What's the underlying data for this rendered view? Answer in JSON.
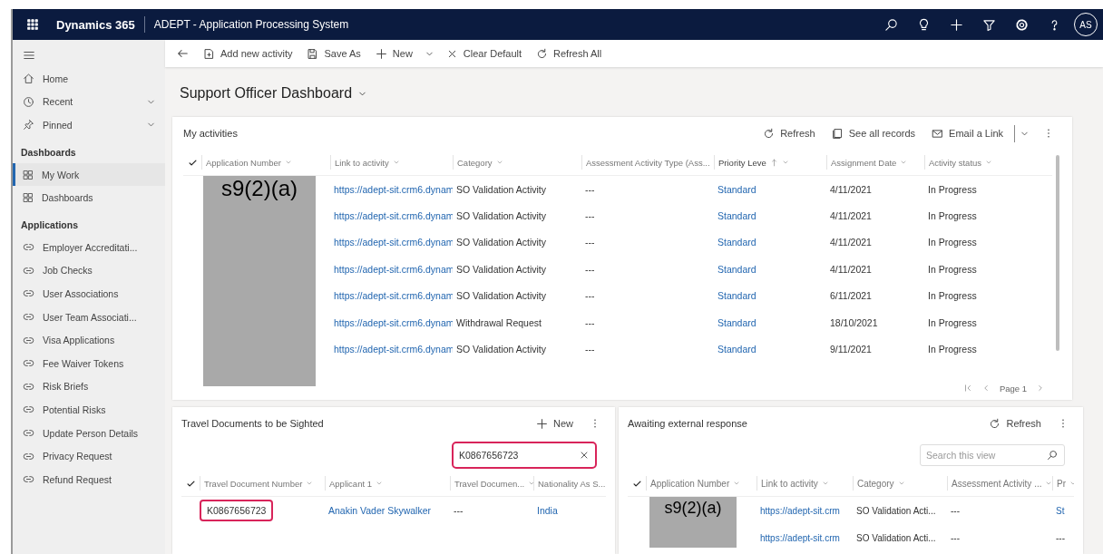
{
  "app_bar": {
    "app_name": "Dynamics 365",
    "title": "ADEPT - Application Processing System",
    "avatar": "AS"
  },
  "sidebar": {
    "top_items": [
      {
        "label": "Home",
        "kind": "link"
      },
      {
        "label": "Recent",
        "kind": "group"
      },
      {
        "label": "Pinned",
        "kind": "group"
      }
    ],
    "sections": [
      {
        "title": "Dashboards",
        "items": [
          {
            "label": "My Work",
            "selected": true
          },
          {
            "label": "Dashboards",
            "selected": false
          }
        ]
      },
      {
        "title": "Applications",
        "items": [
          {
            "label": "Employer Accreditati...",
            "selected": false
          },
          {
            "label": "Job Checks",
            "selected": false
          },
          {
            "label": "User Associations",
            "selected": false
          },
          {
            "label": "User Team Associati...",
            "selected": false
          },
          {
            "label": "Visa Applications",
            "selected": false
          },
          {
            "label": "Fee Waiver Tokens",
            "selected": false
          },
          {
            "label": "Risk Briefs",
            "selected": false
          },
          {
            "label": "Potential Risks",
            "selected": false
          },
          {
            "label": "Update Person Details",
            "selected": false
          },
          {
            "label": "Privacy Request",
            "selected": false
          },
          {
            "label": "Refund Request",
            "selected": false
          }
        ]
      }
    ]
  },
  "command_bar": [
    {
      "label": "Add new activity",
      "kind": "button"
    },
    {
      "label": "Save As",
      "kind": "button"
    },
    {
      "label": "New",
      "kind": "split"
    },
    {
      "label": "Clear Default",
      "kind": "button"
    },
    {
      "label": "Refresh All",
      "kind": "button"
    }
  ],
  "page_title": "Support Officer Dashboard",
  "my_activities": {
    "title": "My activities",
    "toolbar": [
      {
        "label": "Refresh",
        "kind": "button"
      },
      {
        "label": "See all records",
        "kind": "button"
      },
      {
        "label": "Email a Link",
        "kind": "split"
      }
    ],
    "table": {
      "redaction": "s9(2)(a)",
      "columns": [
        {
          "label": "Application Number",
          "sorted": false
        },
        {
          "label": "Link to activity",
          "sorted": false
        },
        {
          "label": "Category",
          "sorted": false
        },
        {
          "label": "Assessment Activity Type (Ass...",
          "sorted": false
        },
        {
          "label": "Priority Leve",
          "sorted": true
        },
        {
          "label": "Assignment Date",
          "sorted": false
        },
        {
          "label": "Activity status",
          "sorted": false
        }
      ],
      "rows": [
        {
          "cells": [
            {
              "text": "",
              "kind": "redacted"
            },
            {
              "text": "https://adept-sit.crm6.dynam",
              "kind": "link"
            },
            {
              "text": "SO Validation Activity",
              "kind": "text"
            },
            {
              "text": "---",
              "kind": "text"
            },
            {
              "text": "Standard",
              "kind": "link"
            },
            {
              "text": "4/11/2021",
              "kind": "text"
            },
            {
              "text": "In Progress",
              "kind": "text"
            }
          ]
        },
        {
          "cells": [
            {
              "text": "",
              "kind": "redacted"
            },
            {
              "text": "https://adept-sit.crm6.dynam",
              "kind": "link"
            },
            {
              "text": "SO Validation Activity",
              "kind": "text"
            },
            {
              "text": "---",
              "kind": "text"
            },
            {
              "text": "Standard",
              "kind": "link"
            },
            {
              "text": "4/11/2021",
              "kind": "text"
            },
            {
              "text": "In Progress",
              "kind": "text"
            }
          ]
        },
        {
          "cells": [
            {
              "text": "",
              "kind": "redacted"
            },
            {
              "text": "https://adept-sit.crm6.dynam",
              "kind": "link"
            },
            {
              "text": "SO Validation Activity",
              "kind": "text"
            },
            {
              "text": "---",
              "kind": "text"
            },
            {
              "text": "Standard",
              "kind": "link"
            },
            {
              "text": "4/11/2021",
              "kind": "text"
            },
            {
              "text": "In Progress",
              "kind": "text"
            }
          ]
        },
        {
          "cells": [
            {
              "text": "",
              "kind": "redacted"
            },
            {
              "text": "https://adept-sit.crm6.dynam",
              "kind": "link"
            },
            {
              "text": "SO Validation Activity",
              "kind": "text"
            },
            {
              "text": "---",
              "kind": "text"
            },
            {
              "text": "Standard",
              "kind": "link"
            },
            {
              "text": "4/11/2021",
              "kind": "text"
            },
            {
              "text": "In Progress",
              "kind": "text"
            }
          ]
        },
        {
          "cells": [
            {
              "text": "",
              "kind": "redacted"
            },
            {
              "text": "https://adept-sit.crm6.dynam",
              "kind": "link"
            },
            {
              "text": "SO Validation Activity",
              "kind": "text"
            },
            {
              "text": "---",
              "kind": "text"
            },
            {
              "text": "Standard",
              "kind": "link"
            },
            {
              "text": "6/11/2021",
              "kind": "text"
            },
            {
              "text": "In Progress",
              "kind": "text"
            }
          ]
        },
        {
          "cells": [
            {
              "text": "",
              "kind": "redacted"
            },
            {
              "text": "https://adept-sit.crm6.dynam",
              "kind": "link"
            },
            {
              "text": "Withdrawal Request",
              "kind": "text"
            },
            {
              "text": "---",
              "kind": "text"
            },
            {
              "text": "Standard",
              "kind": "link"
            },
            {
              "text": "18/10/2021",
              "kind": "text"
            },
            {
              "text": "In Progress",
              "kind": "text"
            }
          ]
        },
        {
          "cells": [
            {
              "text": "",
              "kind": "redacted"
            },
            {
              "text": "https://adept-sit.crm6.dynam",
              "kind": "link"
            },
            {
              "text": "SO Validation Activity",
              "kind": "text"
            },
            {
              "text": "---",
              "kind": "text"
            },
            {
              "text": "Standard",
              "kind": "link"
            },
            {
              "text": "9/11/2021",
              "kind": "text"
            },
            {
              "text": "In Progress",
              "kind": "text"
            }
          ]
        }
      ]
    },
    "pagination": {
      "label": "Page 1"
    }
  },
  "travel_documents": {
    "title": "Travel Documents to be Sighted",
    "new_label": "New",
    "search": {
      "value": "K0867656723",
      "highlighted": true
    },
    "table": {
      "columns": [
        {
          "label": "Travel Document Number",
          "sorted": false
        },
        {
          "label": "Applicant 1",
          "sorted": false
        },
        {
          "label": "Travel Documen...",
          "sorted": false
        },
        {
          "label": "Nationality As S...",
          "sorted": false
        }
      ],
      "rows": [
        {
          "cells": [
            {
              "text": "K0867656723",
              "kind": "highlight"
            },
            {
              "text": "Anakin Vader Skywalker",
              "kind": "link"
            },
            {
              "text": "---",
              "kind": "text"
            },
            {
              "text": "India",
              "kind": "link"
            }
          ]
        }
      ]
    }
  },
  "awaiting": {
    "title": "Awaiting external response",
    "refresh_label": "Refresh",
    "search": {
      "placeholder": "Search this view",
      "highlighted": false
    },
    "table": {
      "redaction": "s9(2)(a)",
      "columns": [
        {
          "label": "Application Number",
          "sorted": false
        },
        {
          "label": "Link to activity",
          "sorted": false
        },
        {
          "label": "Category",
          "sorted": false
        },
        {
          "label": "Assessment Activity ...",
          "sorted": false
        },
        {
          "label": "Pr",
          "sorted": false
        }
      ],
      "rows": [
        {
          "cells": [
            {
              "text": "",
              "kind": "redacted"
            },
            {
              "text": "https://adept-sit.crm",
              "kind": "link"
            },
            {
              "text": "SO Validation Acti...",
              "kind": "text"
            },
            {
              "text": "---",
              "kind": "text"
            },
            {
              "text": "St",
              "kind": "link"
            }
          ]
        },
        {
          "cells": [
            {
              "text": "",
              "kind": "redacted"
            },
            {
              "text": "https://adept-sit.crm",
              "kind": "link"
            },
            {
              "text": "SO Validation Acti...",
              "kind": "text"
            },
            {
              "text": "---",
              "kind": "text"
            },
            {
              "text": "---",
              "kind": "text"
            }
          ]
        }
      ]
    }
  }
}
